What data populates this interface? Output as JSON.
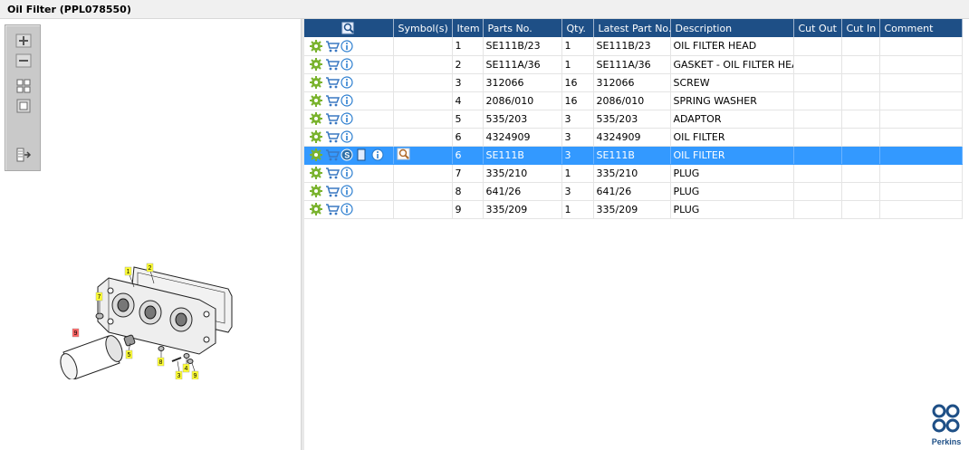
{
  "window": {
    "title": "Oil Filter (PPL078550)"
  },
  "toolbar": {
    "buttons": [
      {
        "name": "zoom-in-button",
        "icon": "zoom-in-icon"
      },
      {
        "name": "zoom-out-button",
        "icon": "zoom-out-icon"
      },
      {
        "name": "fit-all-button",
        "icon": "fit-all-icon"
      },
      {
        "name": "actual-size-button",
        "icon": "actual-size-icon"
      },
      {
        "name": "export-button",
        "icon": "export-icon"
      }
    ]
  },
  "diagram": {
    "callouts": [
      "1",
      "2",
      "7",
      "9",
      "5",
      "8",
      "3",
      "4",
      "9"
    ]
  },
  "table": {
    "headers": [
      "",
      "Symbol(s)",
      "Item",
      "Parts No.",
      "Qty.",
      "Latest Part No.",
      "Description",
      "Cut Out",
      "Cut In",
      "Comment"
    ],
    "rows": [
      {
        "item": "1",
        "part": "SE111B/23",
        "qty": "1",
        "latest": "SE111B/23",
        "desc": "OIL FILTER HEAD"
      },
      {
        "item": "2",
        "part": "SE111A/36",
        "qty": "1",
        "latest": "SE111A/36",
        "desc": "GASKET - OIL FILTER HEAD"
      },
      {
        "item": "3",
        "part": "312066",
        "qty": "16",
        "latest": "312066",
        "desc": "SCREW"
      },
      {
        "item": "4",
        "part": "2086/010",
        "qty": "16",
        "latest": "2086/010",
        "desc": "SPRING WASHER"
      },
      {
        "item": "5",
        "part": "535/203",
        "qty": "3",
        "latest": "535/203",
        "desc": "ADAPTOR"
      },
      {
        "item": "6",
        "part": "4324909",
        "qty": "3",
        "latest": "4324909",
        "desc": "OIL FILTER"
      },
      {
        "item": "6",
        "part": "SE111B",
        "qty": "3",
        "latest": "SE111B",
        "desc": "OIL FILTER",
        "selected": true
      },
      {
        "item": "7",
        "part": "335/210",
        "qty": "1",
        "latest": "335/210",
        "desc": "PLUG"
      },
      {
        "item": "8",
        "part": "641/26",
        "qty": "3",
        "latest": "641/26",
        "desc": "PLUG"
      },
      {
        "item": "9",
        "part": "335/209",
        "qty": "1",
        "latest": "335/209",
        "desc": "PLUG"
      }
    ]
  },
  "brand": {
    "name": "Perkins"
  },
  "colors": {
    "header": "#1e4f86",
    "selected": "#3399ff",
    "gear": "#7ab32e",
    "cart": "#3a78c2",
    "info": "#2d7fd0"
  }
}
